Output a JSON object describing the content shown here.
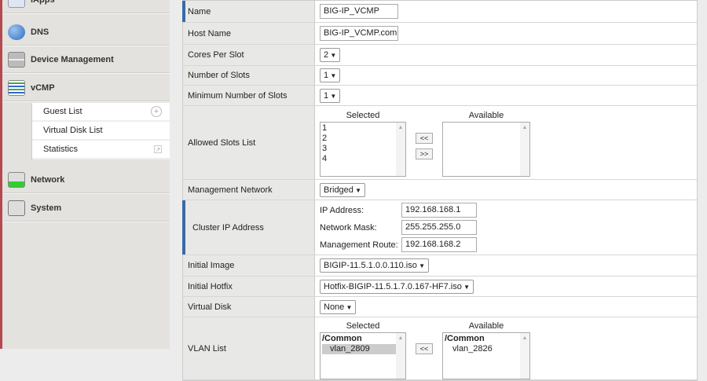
{
  "sidebar": {
    "items": [
      {
        "label": "iApps",
        "icon": "iapps-icon"
      },
      {
        "label": "DNS",
        "icon": "globe-icon"
      },
      {
        "label": "Device Management",
        "icon": "server-icon"
      },
      {
        "label": "vCMP",
        "icon": "vcmp-icon"
      },
      {
        "label": "Network",
        "icon": "network-icon"
      },
      {
        "label": "System",
        "icon": "system-icon"
      }
    ],
    "sub_items": [
      {
        "label": "Guest List",
        "icon": "add-icon"
      },
      {
        "label": "Virtual Disk List"
      },
      {
        "label": "Statistics",
        "icon": "external-link-icon"
      }
    ]
  },
  "form": {
    "name": {
      "label": "Name",
      "value": "BIG-IP_VCMP"
    },
    "host_name": {
      "label": "Host Name",
      "value": "BIG-IP_VCMP.com"
    },
    "cores": {
      "label": "Cores Per Slot",
      "value": "2"
    },
    "slots": {
      "label": "Number of Slots",
      "value": "1"
    },
    "min_slots": {
      "label": "Minimum Number of Slots",
      "value": "1"
    },
    "allowed": {
      "label": "Allowed Slots List",
      "selected_header": "Selected",
      "available_header": "Available",
      "selected": [
        "1",
        "2",
        "3",
        "4"
      ],
      "add": "<<",
      "remove": ">>"
    },
    "mgmt_network": {
      "label": "Management Network",
      "value": "Bridged"
    },
    "cluster": {
      "label": "Cluster IP Address",
      "ip_label": "IP Address:",
      "ip": "192.168.168.1",
      "mask_label": "Network Mask:",
      "mask": "255.255.255.0",
      "route_label": "Management Route:",
      "route": "192.168.168.2"
    },
    "image": {
      "label": "Initial Image",
      "value": "BIGIP-11.5.1.0.0.110.iso"
    },
    "hotfix": {
      "label": "Initial Hotfix",
      "value": "Hotfix-BIGIP-11.5.1.7.0.167-HF7.iso"
    },
    "vdisk": {
      "label": "Virtual Disk",
      "value": "None"
    },
    "vlan": {
      "label": "VLAN List",
      "selected_header": "Selected",
      "available_header": "Available",
      "selected": [
        "/Common",
        "vlan_2809"
      ],
      "available": [
        "/Common",
        "vlan_2826"
      ],
      "add": "<<"
    }
  }
}
